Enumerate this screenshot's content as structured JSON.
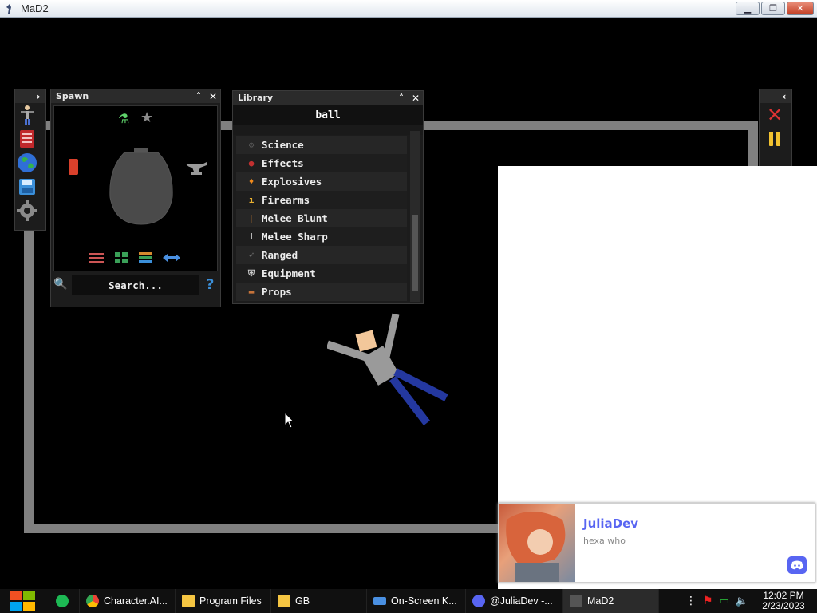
{
  "window": {
    "title": "MaD2"
  },
  "spawn_panel": {
    "title": "Spawn",
    "search_label": "Search..."
  },
  "library_panel": {
    "title": "Library",
    "header": "ball",
    "categories": [
      "Science",
      "Effects",
      "Explosives",
      "Firearms",
      "Melee Blunt",
      "Melee Sharp",
      "Ranged",
      "Equipment",
      "Props"
    ]
  },
  "toast": {
    "sender": "JuliaDev",
    "message": "hexa who"
  },
  "taskbar": {
    "items": [
      "Character.AI...",
      "Program Files",
      "GB",
      "On-Screen K...",
      "@JuliaDev -...",
      "MaD2"
    ],
    "time": "12:02 PM",
    "date": "2/23/2023"
  },
  "colors": {
    "accent": "#5865F2",
    "wall": "#808080",
    "taskbar": "#101010"
  }
}
